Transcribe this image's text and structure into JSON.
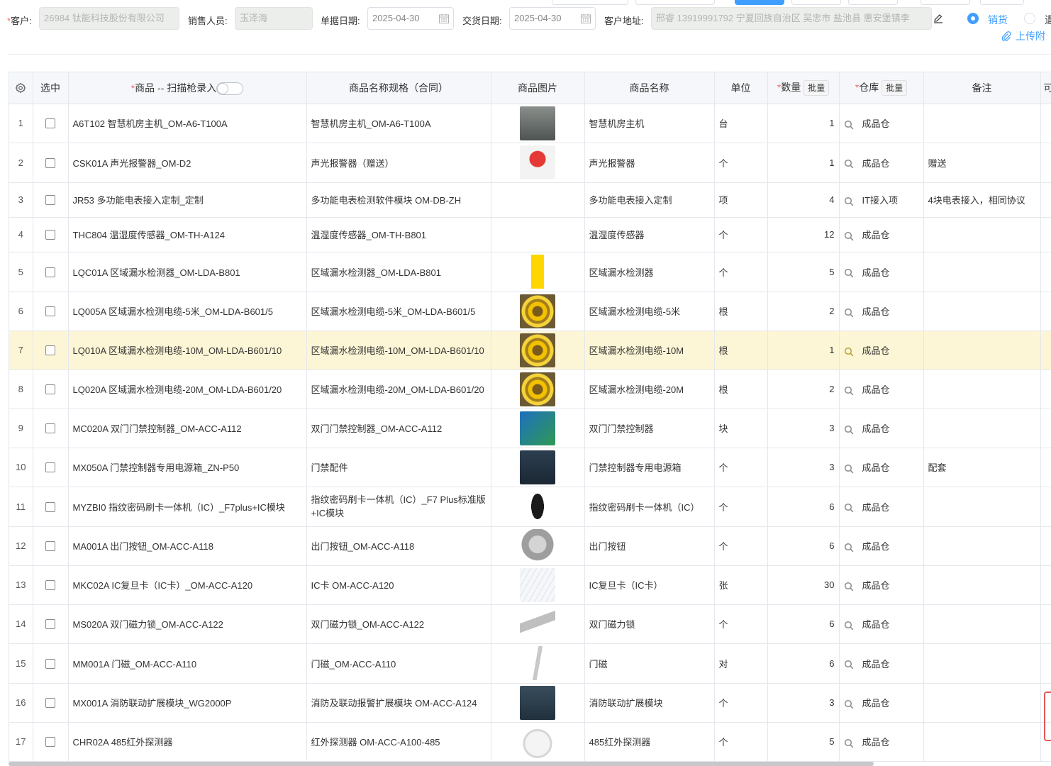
{
  "header": {
    "customer_label": "客户:",
    "customer_value": "26984 钛能科技股份有限公司",
    "salesperson_label": "销售人员:",
    "salesperson_value": "玉泽海",
    "doc_date_label": "单据日期:",
    "doc_date_value": "2025-04-30",
    "delivery_date_label": "交货日期:",
    "delivery_date_value": "2025-04-30",
    "address_label": "客户地址:",
    "address_value": "邢睿 13919991792 宁夏回族自治区 吴忠市 盐池县 惠安堡镇李",
    "radio_sale_label": "销货",
    "radio_return_label": "退",
    "upload_label": "上传附"
  },
  "table": {
    "columns": {
      "select": "选中",
      "product": "商品 -- 扫描枪录入",
      "spec": "商品名称规格（合同）",
      "image": "商品图片",
      "name": "商品名称",
      "unit": "单位",
      "qty": "数量",
      "warehouse": "仓库",
      "remark": "备注",
      "more": "可"
    },
    "batch_label": "批量",
    "rows": [
      {
        "idx": "1",
        "product": "A6T102 智慧机房主机_OM-A6-T100A",
        "spec": "智慧机房主机_OM-A6-T100A",
        "image": "gray",
        "name": "智慧机房主机",
        "unit": "台",
        "qty": "1",
        "warehouse": "成品仓",
        "remark": ""
      },
      {
        "idx": "2",
        "product": "CSK01A 声光报警器_OM-D2",
        "spec": "声光报警器（赠送）",
        "image": "siren",
        "name": "声光报警器",
        "unit": "个",
        "qty": "1",
        "warehouse": "成品仓",
        "remark": "赠送"
      },
      {
        "idx": "3",
        "product": "JR53 多功能电表接入定制_定制",
        "spec": "多功能电表检测软件模块 OM-DB-ZH",
        "image": "",
        "name": "多功能电表接入定制",
        "unit": "项",
        "qty": "4",
        "warehouse": "IT接入项",
        "remark": "4块电表接入，相同协议"
      },
      {
        "idx": "4",
        "product": "THC804 温湿度传感器_OM-TH-A124",
        "spec": "温湿度传感器_OM-TH-B801",
        "image": "",
        "name": "温湿度传感器",
        "unit": "个",
        "qty": "12",
        "warehouse": "成品仓",
        "remark": ""
      },
      {
        "idx": "5",
        "product": "LQC01A 区域漏水检测器_OM-LDA-B801",
        "spec": "区域漏水检测器_OM-LDA-B801",
        "image": "yellow",
        "name": "区域漏水检测器",
        "unit": "个",
        "qty": "5",
        "warehouse": "成品仓",
        "remark": ""
      },
      {
        "idx": "6",
        "product": "LQ005A 区域漏水检测电缆-5米_OM-LDA-B601/5",
        "spec": "区域漏水检测电缆-5米_OM-LDA-B601/5",
        "image": "cable",
        "name": "区域漏水检测电缆-5米",
        "unit": "根",
        "qty": "2",
        "warehouse": "成品仓",
        "remark": ""
      },
      {
        "idx": "7",
        "product": "LQ010A 区域漏水检测电缆-10M_OM-LDA-B601/10",
        "spec": "区域漏水检测电缆-10M_OM-LDA-B601/10",
        "image": "cable",
        "name": "区域漏水检测电缆-10M",
        "unit": "根",
        "qty": "1",
        "warehouse": "成品仓",
        "remark": ""
      },
      {
        "idx": "8",
        "product": "LQ020A 区域漏水检测电缆-20M_OM-LDA-B601/20",
        "spec": "区域漏水检测电缆-20M_OM-LDA-B601/20",
        "image": "cable",
        "name": "区域漏水检测电缆-20M",
        "unit": "根",
        "qty": "2",
        "warehouse": "成品仓",
        "remark": ""
      },
      {
        "idx": "9",
        "product": "MC020A 双门门禁控制器_OM-ACC-A112",
        "spec": "双门门禁控制器_OM-ACC-A112",
        "image": "board",
        "name": "双门门禁控制器",
        "unit": "块",
        "qty": "3",
        "warehouse": "成品仓",
        "remark": ""
      },
      {
        "idx": "10",
        "product": "MX050A 门禁控制器专用电源箱_ZN-P50",
        "spec": "门禁配件",
        "image": "box",
        "name": "门禁控制器专用电源箱",
        "unit": "个",
        "qty": "3",
        "warehouse": "成品仓",
        "remark": "配套"
      },
      {
        "idx": "11",
        "product": "MYZBI0 指纹密码刷卡一体机（IC）_F7plus+IC模块",
        "spec": "指纹密码刷卡一体机（IC）_F7 Plus标准版+IC模块",
        "image": "reader",
        "name": "指纹密码刷卡一体机（IC）",
        "unit": "个",
        "qty": "6",
        "warehouse": "成品仓",
        "remark": ""
      },
      {
        "idx": "12",
        "product": "MA001A 出门按钮_OM-ACC-A118",
        "spec": "出门按钮_OM-ACC-A118",
        "image": "button",
        "name": "出门按钮",
        "unit": "个",
        "qty": "6",
        "warehouse": "成品仓",
        "remark": ""
      },
      {
        "idx": "13",
        "product": "MKC02A IC复旦卡（IC卡）_OM-ACC-A120",
        "spec": "IC卡 OM-ACC-A120",
        "image": "cards",
        "name": "IC复旦卡（IC卡）",
        "unit": "张",
        "qty": "30",
        "warehouse": "成品仓",
        "remark": ""
      },
      {
        "idx": "14",
        "product": "MS020A 双门磁力锁_OM-ACC-A122",
        "spec": "双门磁力锁_OM-ACC-A122",
        "image": "lock",
        "name": "双门磁力锁",
        "unit": "个",
        "qty": "6",
        "warehouse": "成品仓",
        "remark": ""
      },
      {
        "idx": "15",
        "product": "MM001A 门磁_OM-ACC-A110",
        "spec": "门磁_OM-ACC-A110",
        "image": "mag",
        "name": "门磁",
        "unit": "对",
        "qty": "6",
        "warehouse": "成品仓",
        "remark": ""
      },
      {
        "idx": "16",
        "product": "MX001A 消防联动扩展模块_WG2000P",
        "spec": "消防及联动报警扩展模块 OM-ACC-A124",
        "image": "module",
        "name": "消防联动扩展模块",
        "unit": "个",
        "qty": "3",
        "warehouse": "成品仓",
        "remark": ""
      },
      {
        "idx": "17",
        "product": "CHR02A 485红外探测器",
        "spec": "红外探测器 OM-ACC-A100-485",
        "image": "pir",
        "name": "485红外探测器",
        "unit": "个",
        "qty": "5",
        "warehouse": "成品仓",
        "remark": ""
      }
    ]
  },
  "colors": {
    "accent": "#409eff",
    "required": "#f56c6c",
    "highlight_row": "#fdf6d6",
    "header_bg": "#f5f7fa"
  }
}
